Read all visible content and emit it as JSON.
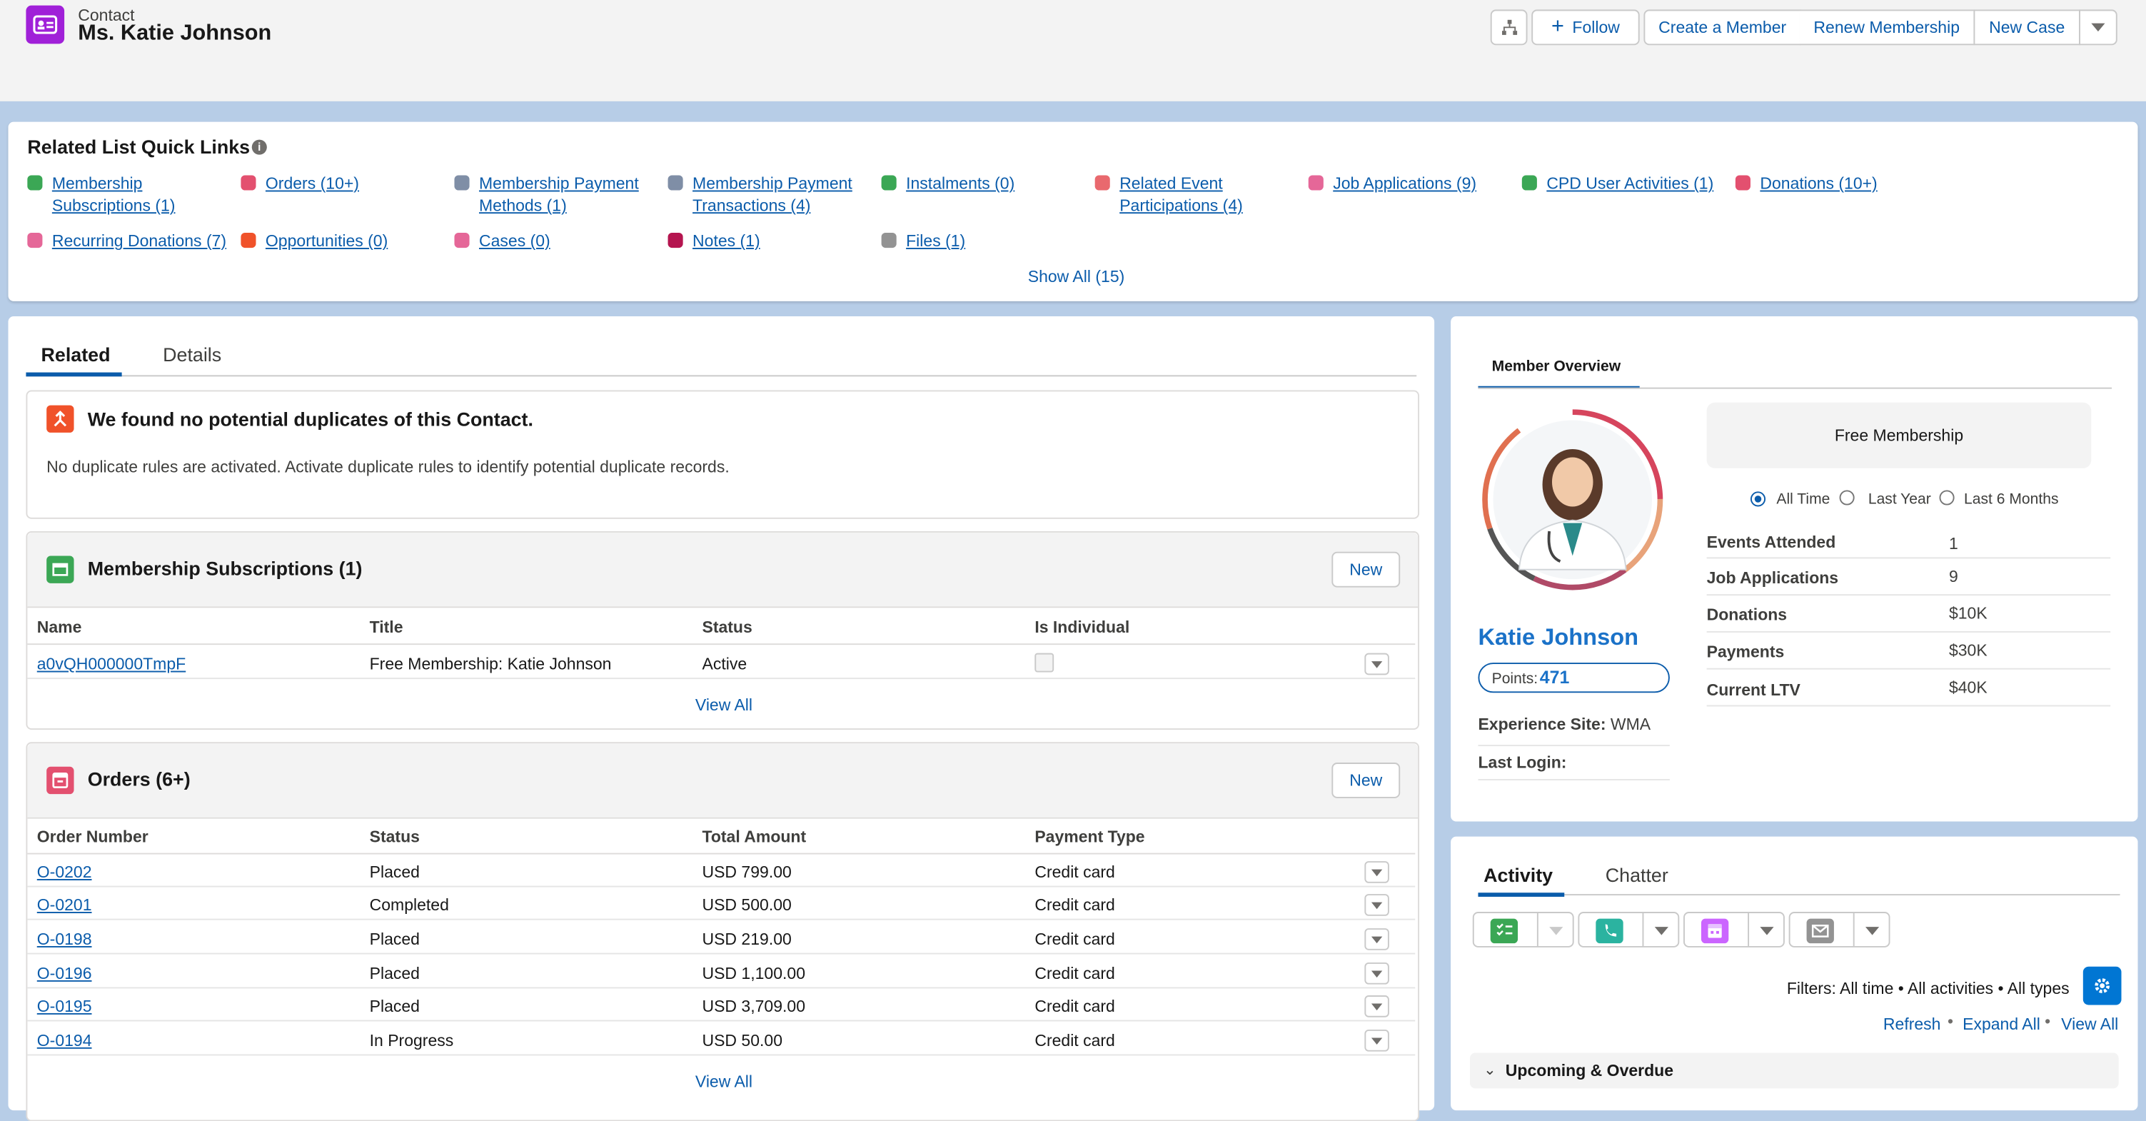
{
  "header": {
    "object_type": "Contact",
    "record_name": "Ms. Katie Johnson",
    "buttons": {
      "follow": "Follow",
      "create_member": "Create a Member",
      "renew": "Renew Membership",
      "new_case": "New Case"
    }
  },
  "quick_links": {
    "title": "Related List Quick Links",
    "items": [
      {
        "label_1": "Membership",
        "label_2": "Subscriptions (1)",
        "color": "#3ba755"
      },
      {
        "label_1": "Orders (10+)",
        "label_2": "",
        "color": "#e3506f"
      },
      {
        "label_1": "Membership Payment",
        "label_2": "Methods (1)",
        "color": "#7f8ea6"
      },
      {
        "label_1": "Membership Payment",
        "label_2": "Transactions (4)",
        "color": "#7f8ea6"
      },
      {
        "label_1": "Instalments (0)",
        "label_2": "",
        "color": "#3ba755"
      },
      {
        "label_1": "Related Event",
        "label_2": "Participations (4)",
        "color": "#e9696e"
      },
      {
        "label_1": "Job Applications (9)",
        "label_2": "",
        "color": "#e56798"
      },
      {
        "label_1": "CPD User Activities (1)",
        "label_2": "",
        "color": "#3ba755"
      },
      {
        "label_1": "Donations (10+)",
        "label_2": "",
        "color": "#e3506f"
      },
      {
        "label_1": "Recurring Donations (7)",
        "label_2": "",
        "color": "#e56798"
      },
      {
        "label_1": "Opportunities (0)",
        "label_2": "",
        "color": "#f0522a"
      },
      {
        "label_1": "Cases (0)",
        "label_2": "",
        "color": "#e56798"
      },
      {
        "label_1": "Notes (1)",
        "label_2": "",
        "color": "#b5154f"
      },
      {
        "label_1": "Files (1)",
        "label_2": "",
        "color": "#939393"
      }
    ],
    "show_all": "Show All (15)"
  },
  "left_tabs": {
    "related": "Related",
    "details": "Details"
  },
  "duplicates": {
    "title": "We found no potential duplicates of this Contact.",
    "message": "No duplicate rules are activated. Activate duplicate rules to identify potential duplicate records."
  },
  "subscriptions": {
    "title": "Membership Subscriptions (1)",
    "new_label": "New",
    "headers": [
      "Name",
      "Title",
      "Status",
      "Is Individual"
    ],
    "row": {
      "name": "a0vQH000000TmpF",
      "title": "Free Membership: Katie Johnson",
      "status": "Active"
    },
    "view_all": "View All"
  },
  "orders": {
    "title": "Orders (6+)",
    "new_label": "New",
    "headers": [
      "Order Number",
      "Status",
      "Total Amount",
      "Payment Type"
    ],
    "rows": [
      {
        "number": "O-0202",
        "status": "Placed",
        "amount": "USD 799.00",
        "payment": "Credit card"
      },
      {
        "number": "O-0201",
        "status": "Completed",
        "amount": "USD 500.00",
        "payment": "Credit card"
      },
      {
        "number": "O-0198",
        "status": "Placed",
        "amount": "USD 219.00",
        "payment": "Credit card"
      },
      {
        "number": "O-0196",
        "status": "Placed",
        "amount": "USD 1,100.00",
        "payment": "Credit card"
      },
      {
        "number": "O-0195",
        "status": "Placed",
        "amount": "USD 3,709.00",
        "payment": "Credit card"
      },
      {
        "number": "O-0194",
        "status": "In Progress",
        "amount": "USD 50.00",
        "payment": "Credit card"
      }
    ],
    "view_all": "View All"
  },
  "member_overview": {
    "tab": "Member Overview",
    "membership": "Free Membership",
    "name": "Katie Johnson",
    "points_label": "Points:",
    "points": "471",
    "experience_label": "Experience Site:",
    "experience_value": "WMA",
    "last_login_label": "Last Login:",
    "ranges": [
      "All Time",
      "Last Year",
      "Last 6 Months"
    ],
    "stats": [
      {
        "label": "Events Attended",
        "value": "1"
      },
      {
        "label": "Job Applications",
        "value": "9"
      },
      {
        "label": "Donations",
        "value": "$10K"
      },
      {
        "label": "Payments",
        "value": "$30K"
      },
      {
        "label": "Current LTV",
        "value": "$40K"
      }
    ]
  },
  "activity": {
    "tabs": {
      "activity": "Activity",
      "chatter": "Chatter"
    },
    "filters": "Filters: All time • All activities • All types",
    "refresh": "Refresh",
    "expand_all": "Expand All",
    "view_all": "View All",
    "upcoming": "Upcoming & Overdue"
  }
}
